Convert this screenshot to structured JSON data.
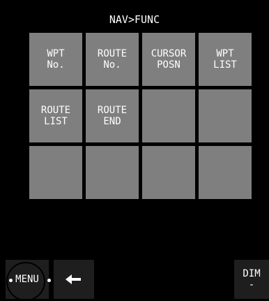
{
  "header": {
    "title": "NAV>FUNC"
  },
  "keys": [
    {
      "label": "WPT\nNo."
    },
    {
      "label": "ROUTE\nNo."
    },
    {
      "label": "CURSOR\nPOSN"
    },
    {
      "label": "WPT\nLIST"
    },
    {
      "label": "ROUTE\nLIST"
    },
    {
      "label": "ROUTE\nEND"
    },
    {
      "label": ""
    },
    {
      "label": ""
    },
    {
      "label": ""
    },
    {
      "label": ""
    },
    {
      "label": ""
    },
    {
      "label": ""
    }
  ],
  "bottom": {
    "menu_label": "MENU",
    "back_icon": "arrow-left-icon",
    "dim_label": "DIM",
    "dim_value": "-"
  },
  "colors": {
    "background": "#000000",
    "key": "#7f7f7f",
    "bottom_button": "#1e1e1e",
    "text": "#ffffff"
  }
}
